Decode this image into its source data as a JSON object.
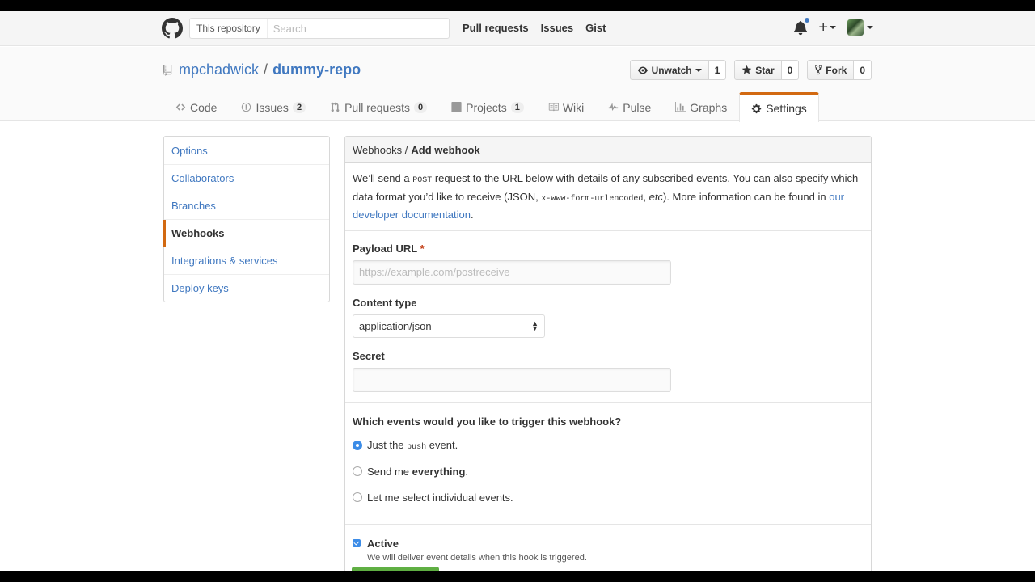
{
  "header": {
    "search_scope": "This repository",
    "search_placeholder": "Search",
    "nav": [
      "Pull requests",
      "Issues",
      "Gist"
    ]
  },
  "repo": {
    "owner": "mpchadwick",
    "separator": "/",
    "name": "dummy-repo",
    "unwatch_label": "Unwatch",
    "watch_count": "1",
    "star_label": "Star",
    "star_count": "0",
    "fork_label": "Fork",
    "fork_count": "0"
  },
  "tabs": {
    "code": "Code",
    "issues": "Issues",
    "issues_count": "2",
    "pulls": "Pull requests",
    "pulls_count": "0",
    "projects": "Projects",
    "projects_count": "1",
    "wiki": "Wiki",
    "pulse": "Pulse",
    "graphs": "Graphs",
    "settings": "Settings"
  },
  "menu": [
    "Options",
    "Collaborators",
    "Branches",
    "Webhooks",
    "Integrations & services",
    "Deploy keys"
  ],
  "box": {
    "crumb_parent": "Webhooks /",
    "crumb_current": "Add webhook",
    "intro_1": "We’ll send a ",
    "intro_post": "POST",
    "intro_2": " request to the URL below with details of any subscribed events. You can also specify which data format you’d like to receive (JSON, ",
    "intro_form": "x-www-form-urlencoded",
    "intro_3": ", ",
    "intro_etc": "etc",
    "intro_4": "). More information can be found in ",
    "intro_link": "our developer documentation",
    "intro_5": "."
  },
  "form": {
    "payload_label": "Payload URL",
    "required_mark": "*",
    "payload_placeholder": "https://example.com/postreceive",
    "content_type_label": "Content type",
    "content_type_value": "application/json",
    "secret_label": "Secret"
  },
  "events": {
    "question": "Which events would you like to trigger this webhook?",
    "opt1_pre": "Just the ",
    "opt1_code": "push",
    "opt1_post": " event.",
    "opt2_pre": "Send me ",
    "opt2_bold": "everything",
    "opt2_post": ".",
    "opt3": "Let me select individual events.",
    "selected": 1
  },
  "active": {
    "label": "Active",
    "note": "We will deliver event details when this hook is triggered.",
    "checked": true
  },
  "colors": {
    "accent_orange": "#d26911",
    "link_blue": "#4078c0",
    "radio_blue": "#3c8ce7",
    "add_green": "#55a532"
  }
}
